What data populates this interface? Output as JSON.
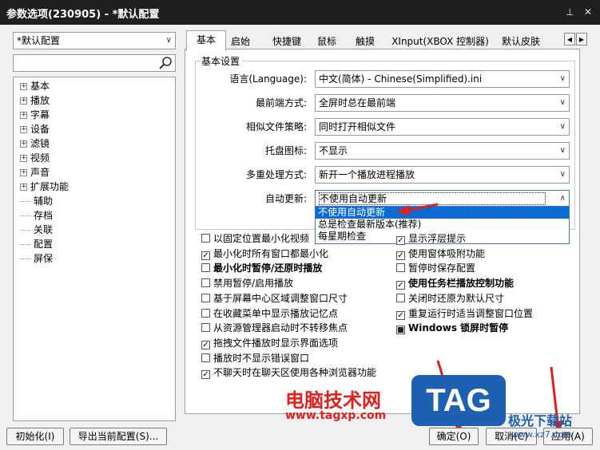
{
  "window": {
    "title": "参数选项(230905) - *默认配置",
    "pin_glyph": "⊥",
    "close_glyph": "✕"
  },
  "left": {
    "profile_select": "*默认配置",
    "search_placeholder": "",
    "tree": [
      {
        "label": "基本",
        "expandable": true
      },
      {
        "label": "播放",
        "expandable": true
      },
      {
        "label": "字幕",
        "expandable": true
      },
      {
        "label": "设备",
        "expandable": true
      },
      {
        "label": "滤镜",
        "expandable": true
      },
      {
        "label": "视频",
        "expandable": true
      },
      {
        "label": "声音",
        "expandable": true
      },
      {
        "label": "扩展功能",
        "expandable": true
      },
      {
        "label": "辅助",
        "expandable": false
      },
      {
        "label": "存档",
        "expandable": false
      },
      {
        "label": "关联",
        "expandable": false
      },
      {
        "label": "配置",
        "expandable": false
      },
      {
        "label": "屏保",
        "expandable": false
      }
    ],
    "init_button": "初始化(I)",
    "export_button": "导出当前配置(S)..."
  },
  "tabs": [
    "基本",
    "启始",
    "快捷键",
    "鼠标",
    "触摸",
    "XInput(XBOX 控制器)",
    "默认皮肤"
  ],
  "tab_scroll": {
    "prev": "◀",
    "next": "▶"
  },
  "group": {
    "title": "基本设置",
    "rows": [
      {
        "label": "语言(Language):",
        "value": "中文(简体) - Chinese(Simplified).ini"
      },
      {
        "label": "最前端方式:",
        "value": "全屏时总在最前端"
      },
      {
        "label": "相似文件策略:",
        "value": "同时打开相似文件"
      },
      {
        "label": "托盘图标:",
        "value": "不显示"
      },
      {
        "label": "多重处理方式:",
        "value": "新开一个播放进程播放"
      },
      {
        "label": "自动更新:",
        "value": "不使用自动更新"
      }
    ],
    "dropdown_options": [
      "不使用自动更新",
      "总是检查最新版本(推荐)",
      "每星期检查"
    ],
    "dropdown_selected_index": 0
  },
  "checkboxes_left": [
    {
      "label": "以固定位置最小化视频",
      "checked": false,
      "bold": false
    },
    {
      "label": "最小化时所有窗口都最小化",
      "checked": true,
      "bold": false
    },
    {
      "label": "最小化时暂停/还原时播放",
      "checked": false,
      "bold": true
    },
    {
      "label": "禁用暂停/启用播放",
      "checked": false,
      "bold": false
    },
    {
      "label": "基于屏幕中心区域调整窗口尺寸",
      "checked": false,
      "bold": false
    },
    {
      "label": "在收藏菜单中显示播放记忆点",
      "checked": false,
      "bold": false
    },
    {
      "label": "从资源管理器启动时不转移焦点",
      "checked": false,
      "bold": false
    },
    {
      "label": "拖拽文件播放时显示界面选项",
      "checked": true,
      "bold": false
    },
    {
      "label": "播放时不显示错误窗口",
      "checked": false,
      "bold": false
    },
    {
      "label": "不聊天时在聊天区使用各种浏览器功能",
      "checked": true,
      "bold": false
    }
  ],
  "checkboxes_right": [
    {
      "label": "显示浮层提示",
      "checked": true,
      "bold": false,
      "partial": false
    },
    {
      "label": "使用窗体吸附功能",
      "checked": true,
      "bold": false,
      "partial": false
    },
    {
      "label": "暂停时保存配置",
      "checked": false,
      "bold": false,
      "partial": false
    },
    {
      "label": "使用任务栏播放控制功能",
      "checked": true,
      "bold": true,
      "partial": false
    },
    {
      "label": "关闭时还原为默认尺寸",
      "checked": false,
      "bold": false,
      "partial": false
    },
    {
      "label": "重复运行时适当调整窗口位置",
      "checked": true,
      "bold": false,
      "partial": false
    },
    {
      "label": "Windows 锁屏时暂停",
      "checked": false,
      "bold": true,
      "partial": true
    }
  ],
  "footer": {
    "ok": "确定(O)",
    "cancel": "取消(C)",
    "apply": "应用(A)"
  },
  "watermark": {
    "site_cn": "电脑技术网",
    "site_url": "www.tagxp.com",
    "logo": "TAG",
    "brand": "极光下载站",
    "brand_url": "www.xz7.com"
  },
  "colors": {
    "titlebar": "#1f1f1f",
    "selection": "#0a6bd2",
    "annotation_arrow": "#e0201a",
    "watermark_blue": "#1d5fb0"
  }
}
